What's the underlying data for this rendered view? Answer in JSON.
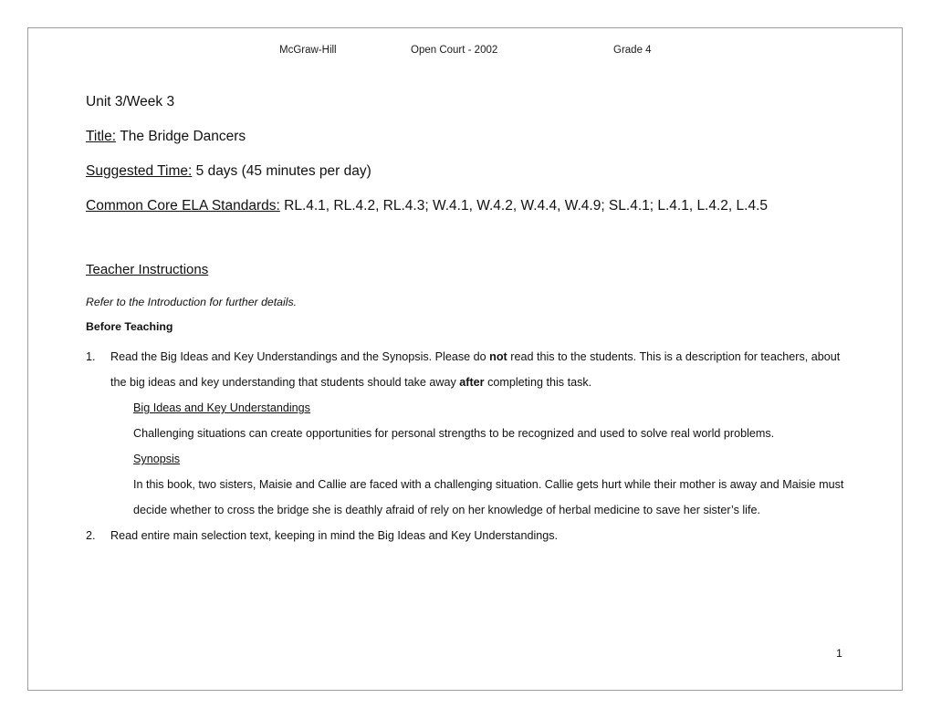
{
  "header": {
    "publisher": "McGraw-Hill",
    "program": "Open Court - 2002",
    "grade": "Grade 4"
  },
  "title_block": {
    "unit_week": "Unit 3/Week 3",
    "title_label": "Title:",
    "title_value": "The Bridge Dancers",
    "suggested_time_label": "Suggested Time:",
    "suggested_time_value": "5 days (45 minutes per day)",
    "standards_label": "Common Core ELA Standards:",
    "standards_value": "RL.4.1, RL.4.2, RL.4.3; W.4.1, W.4.2, W.4.4, W.4.9; SL.4.1; L.4.1, L.4.2, L.4.5"
  },
  "teacher_instructions": {
    "heading": "Teacher Instructions",
    "refer_note": "Refer to the Introduction for further details.",
    "before_teaching_label": "Before Teaching",
    "steps": [
      {
        "number": "1.",
        "text_part_1": "Read the Big Ideas and Key Understandings and the Synopsis.  Please do ",
        "bold_1": "not",
        "text_part_2": " read this to the students.  This is a description for teachers, about the big ideas and key understanding that students should take away ",
        "bold_2": "after",
        "text_part_3": " completing this task."
      },
      {
        "number": "2.",
        "text_part_1": "Read entire main selection text, keeping in mind the Big Ideas and Key Understandings."
      }
    ],
    "big_ideas_label": "Big Ideas and Key Understandings",
    "big_ideas_text": "Challenging situations can create opportunities for personal strengths to be recognized and used to solve real world problems.",
    "synopsis_label": "Synopsis",
    "synopsis_text": "In this book, two sisters, Maisie and Callie are faced with a challenging situation.  Callie gets hurt while their mother is away and Maisie must decide whether to cross the bridge she is deathly afraid of rely on her knowledge of herbal medicine to save her sister’s life."
  },
  "footer": {
    "page_number": "1"
  }
}
